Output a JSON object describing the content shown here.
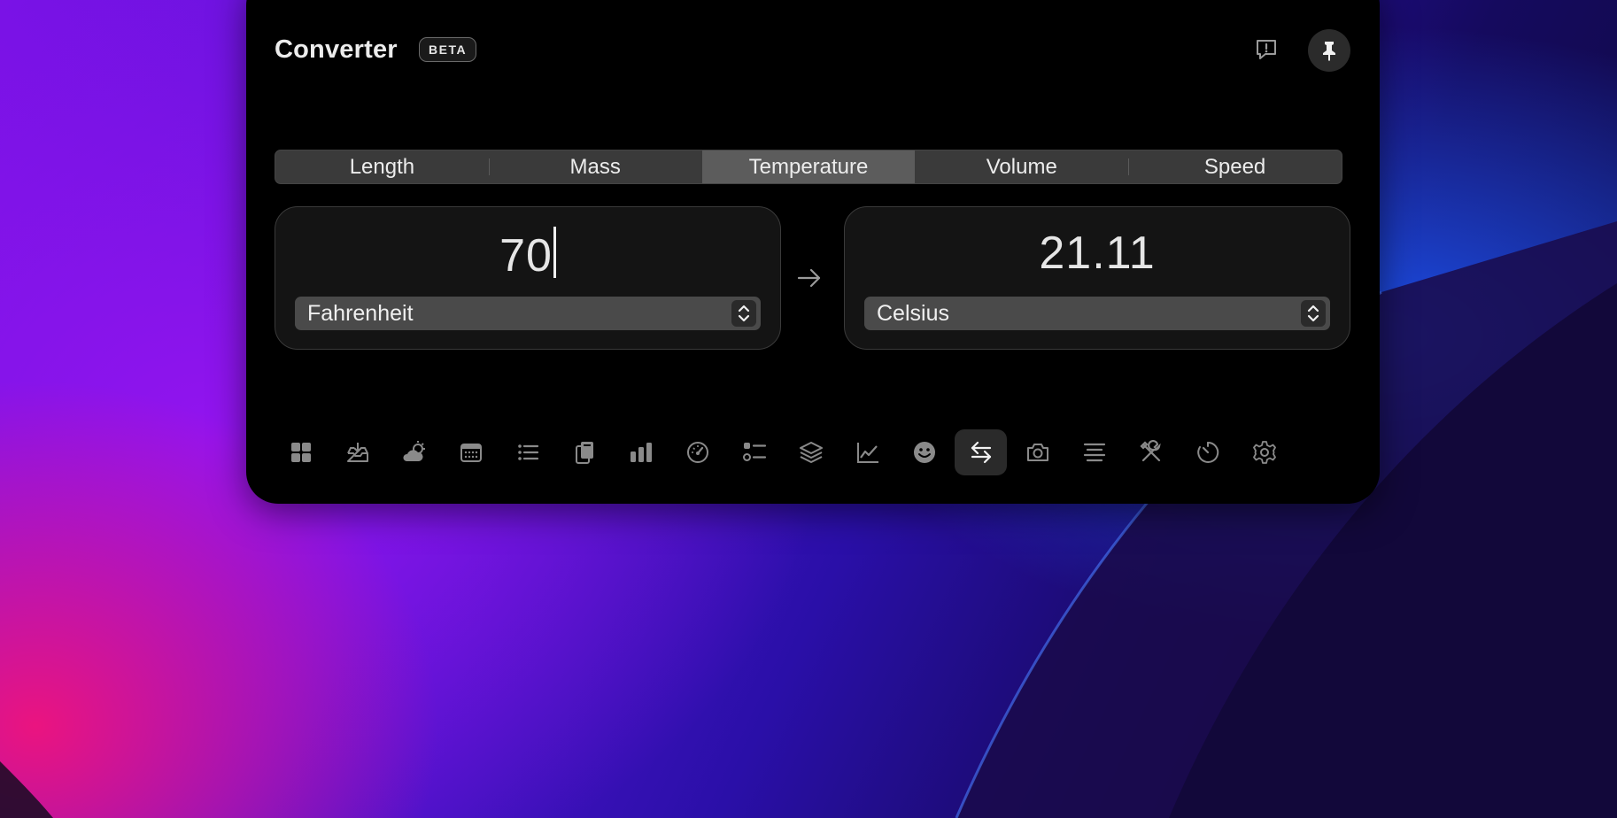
{
  "app": {
    "title": "Converter",
    "badge": "BETA"
  },
  "header": {
    "feedback_icon": "feedback-icon",
    "pin_icon": "pin-icon"
  },
  "tabs": [
    {
      "label": "Length",
      "active": false
    },
    {
      "label": "Mass",
      "active": false
    },
    {
      "label": "Temperature",
      "active": true
    },
    {
      "label": "Volume",
      "active": false
    },
    {
      "label": "Speed",
      "active": false
    }
  ],
  "converter": {
    "input_value": "70",
    "input_unit": "Fahrenheit",
    "output_value": "21.11",
    "output_unit": "Celsius"
  },
  "toolbar": {
    "items": [
      {
        "icon": "widgets-icon"
      },
      {
        "icon": "tray-download-icon"
      },
      {
        "icon": "weather-icon"
      },
      {
        "icon": "calendar-icon"
      },
      {
        "icon": "list-icon"
      },
      {
        "icon": "clipboard-icon"
      },
      {
        "icon": "bar-chart-icon"
      },
      {
        "icon": "gauge-icon"
      },
      {
        "icon": "checklist-icon"
      },
      {
        "icon": "layers-icon"
      },
      {
        "icon": "line-chart-icon"
      },
      {
        "icon": "emoji-icon"
      },
      {
        "icon": "converter-icon",
        "active": true
      },
      {
        "icon": "camera-icon"
      },
      {
        "icon": "text-align-icon"
      },
      {
        "icon": "tools-icon"
      },
      {
        "icon": "timer-icon"
      },
      {
        "icon": "settings-icon"
      }
    ]
  },
  "colors": {
    "panel_bg": "#000000",
    "segment_bg": "#3a3a3a",
    "segment_active": "#5c5c5c",
    "card_bg": "#141414",
    "select_bg": "#4a4a4a",
    "icon": "#8a8a8a"
  }
}
